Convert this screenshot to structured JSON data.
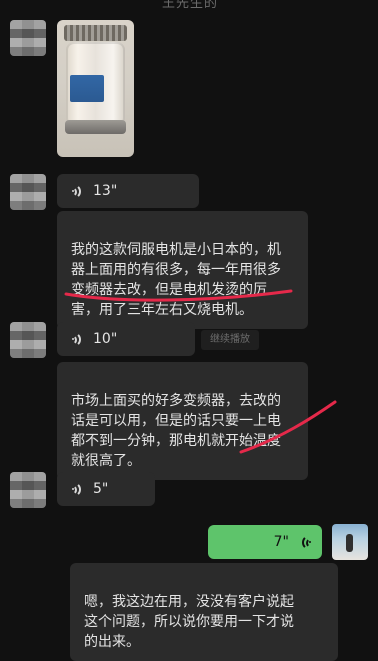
{
  "status": {
    "title": "王先生的"
  },
  "messages": {
    "voice1": {
      "duration": "13\""
    },
    "text1": {
      "content": "我的这款伺服电机是小日本的，机\n器上面用的有很多，每一年用很多\n变频器去改，但是电机发烫的厉\n害，用了三年左右又烧电机。"
    },
    "voice2": {
      "duration": "10\""
    },
    "hint2": {
      "label": "继续播放"
    },
    "text2": {
      "content": "市场上面买的好多变频器，去改的\n话是可以用，但是的话只要一上电\n都不到一分钟，那电机就开始温度\n就很高了。"
    },
    "voice3": {
      "duration": "5\""
    },
    "my_voice": {
      "duration": "7\""
    },
    "text3": {
      "content": "嗯，我这边在用，没没有客户说起\n这个问题，所以说你要用一下才说\n的出来。"
    }
  },
  "colors": {
    "background": "#111111",
    "bubble": "#2b2b2b",
    "text": "#e4e4e4",
    "green": "#5ec46b",
    "red_annotation": "#e5294a"
  },
  "icons": {
    "voice": "speaker-waves-icon",
    "my_voice": "speaker-waves-left-icon",
    "avatar": "blurred-avatar-icon"
  }
}
